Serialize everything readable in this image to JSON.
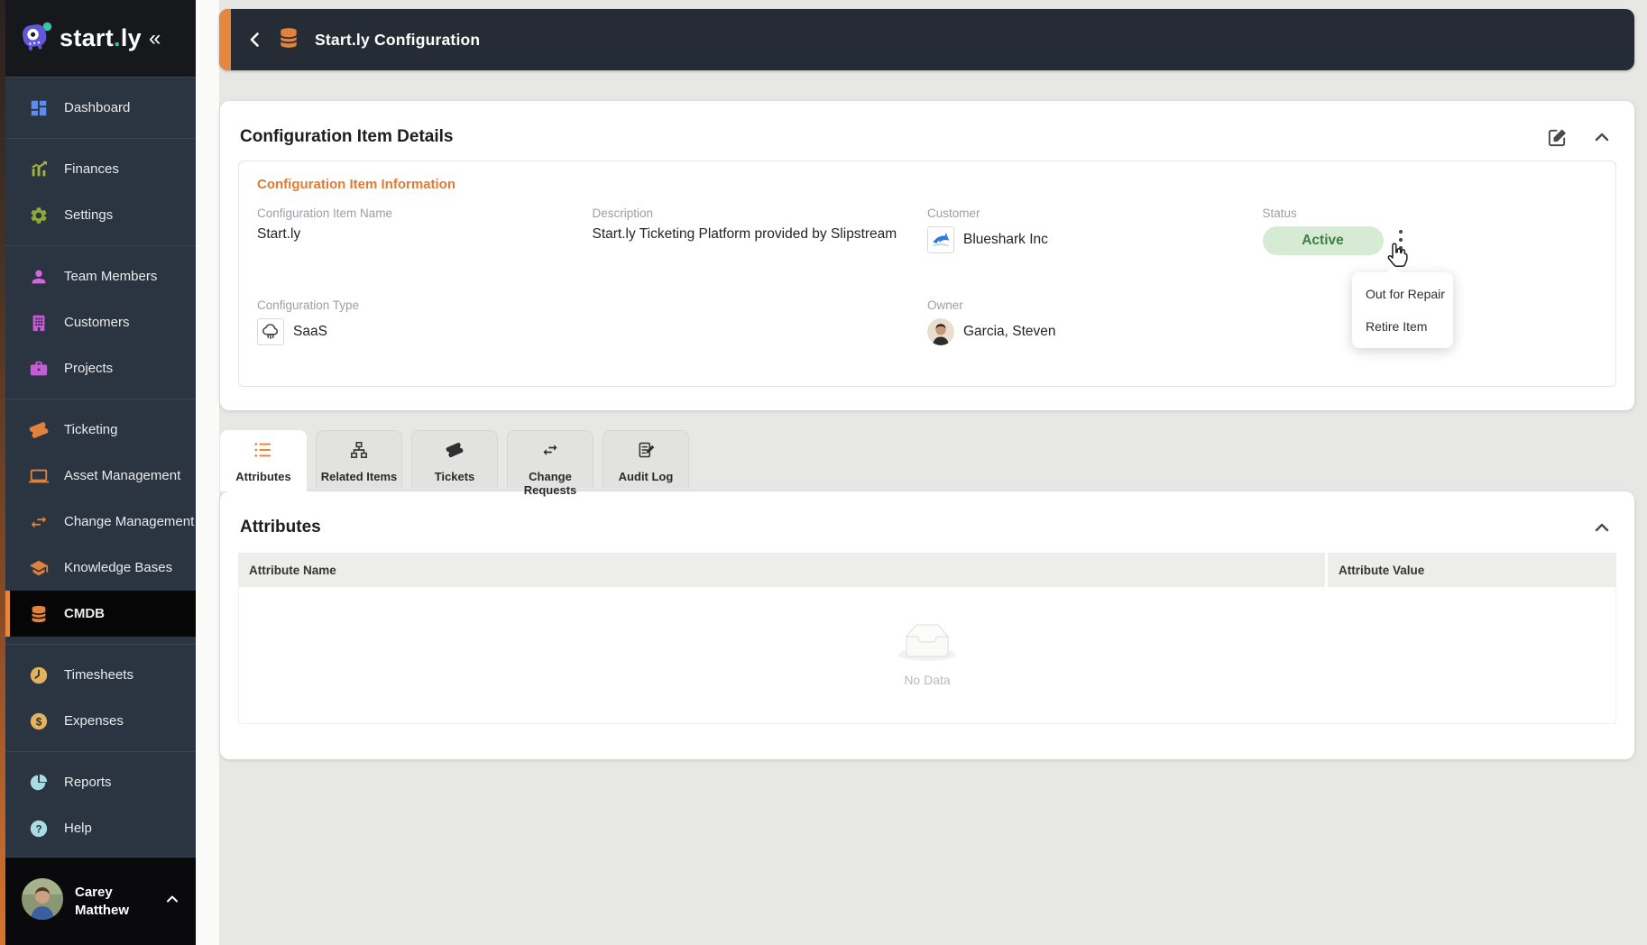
{
  "colors": {
    "accent_orange": "#e5873e",
    "sidebar_bg": "#2b3441",
    "appbar_bg": "#262c35",
    "status_active_bg": "#d6ebd3",
    "status_active_text": "#3f7d42"
  },
  "sidebar": {
    "logo_part1": "start",
    "logo_dot": ".",
    "logo_part2": "ly",
    "collapse_glyph": "«",
    "items": [
      {
        "label": "Dashboard",
        "icon": "dashboard-icon"
      },
      {
        "label": "Finances",
        "icon": "finances-icon"
      },
      {
        "label": "Settings",
        "icon": "settings-icon"
      },
      {
        "label": "Team Members",
        "icon": "team-members-icon"
      },
      {
        "label": "Customers",
        "icon": "customers-icon"
      },
      {
        "label": "Projects",
        "icon": "projects-icon"
      },
      {
        "label": "Ticketing",
        "icon": "ticketing-icon"
      },
      {
        "label": "Asset Management",
        "icon": "asset-management-icon"
      },
      {
        "label": "Change Management",
        "icon": "change-management-icon"
      },
      {
        "label": "Knowledge Bases",
        "icon": "knowledge-bases-icon"
      },
      {
        "label": "CMDB",
        "icon": "cmdb-icon",
        "selected": true
      },
      {
        "label": "Timesheets",
        "icon": "timesheets-icon"
      },
      {
        "label": "Expenses",
        "icon": "expenses-icon"
      },
      {
        "label": "Reports",
        "icon": "reports-icon"
      },
      {
        "label": "Help",
        "icon": "help-icon"
      }
    ],
    "user": {
      "first_name": "Carey",
      "last_name": "Matthew"
    }
  },
  "appbar": {
    "title": "Start.ly Configuration"
  },
  "details": {
    "title": "Configuration Item Details",
    "section_title": "Configuration Item Information",
    "fields": {
      "name": {
        "label": "Configuration Item Name",
        "value": "Start.ly"
      },
      "description": {
        "label": "Description",
        "value": "Start.ly Ticketing Platform provided by Slipstream"
      },
      "customer": {
        "label": "Customer",
        "value": "Blueshark Inc"
      },
      "status": {
        "label": "Status",
        "value": "Active"
      },
      "type": {
        "label": "Configuration Type",
        "value": "SaaS"
      },
      "owner": {
        "label": "Owner",
        "value": "Garcia, Steven"
      }
    }
  },
  "status_menu": {
    "items": [
      {
        "label": "Out for Repair"
      },
      {
        "label": "Retire Item"
      }
    ]
  },
  "tabs": [
    {
      "label": "Attributes",
      "active": true
    },
    {
      "label": "Related Items"
    },
    {
      "label": "Tickets"
    },
    {
      "label": "Change Requests"
    },
    {
      "label": "Audit Log"
    }
  ],
  "attributes_section": {
    "title": "Attributes",
    "columns": [
      {
        "label": "Attribute Name"
      },
      {
        "label": "Attribute Value"
      }
    ],
    "empty_text": "No Data",
    "rows": []
  }
}
